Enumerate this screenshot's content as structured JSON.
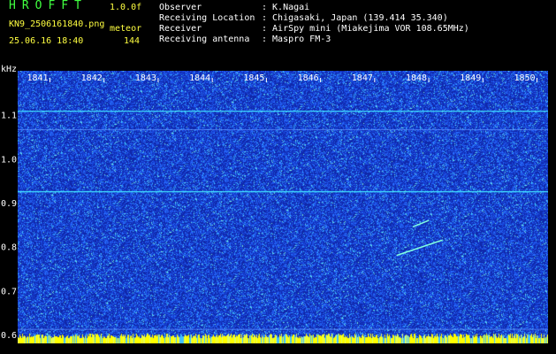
{
  "header": {
    "brand": "HROFFT",
    "version": "1.0.0f",
    "filename": "KN9_2506161840.png",
    "mode": "meteor",
    "datetime": "25.06.16 18:40",
    "count": "144"
  },
  "info": [
    {
      "label": "Observer",
      "value": ": K.Nagai"
    },
    {
      "label": "Receiving Location",
      "value": ": Chigasaki, Japan (139.414 35.340)"
    },
    {
      "label": "Receiver",
      "value": ": AirSpy mini (Miakejima VOR 108.65MHz)"
    },
    {
      "label": "Receiving antenna",
      "value": ": Maspro FM-3"
    }
  ],
  "chart_data": {
    "type": "heatmap",
    "ylabel": "kHz",
    "yticks": [
      "1.1",
      "1.0",
      "0.9",
      "0.8",
      "0.7",
      "0.6"
    ],
    "ytick_values": [
      1.1,
      1.0,
      0.9,
      0.8,
      0.7,
      0.6
    ],
    "ylim": [
      0.58,
      1.2
    ],
    "xticks": [
      "1841",
      "1842",
      "1843",
      "1844",
      "1845",
      "1846",
      "1847",
      "1848",
      "1849",
      "1850"
    ],
    "xtick_values": [
      1841,
      1842,
      1843,
      1844,
      1845,
      1846,
      1847,
      1848,
      1849,
      1850
    ],
    "xlim": [
      1840.6,
      1850.4
    ],
    "carrier_lines_khz": [
      1.108,
      0.925
    ],
    "faint_lines_khz": [
      1.066,
      0.612
    ],
    "meteor_echoes": [
      {
        "x": [
          1847.6,
          1848.45
        ],
        "y": [
          0.78,
          0.815
        ]
      },
      {
        "x": [
          1847.9,
          1848.2
        ],
        "y": [
          0.845,
          0.86
        ]
      }
    ],
    "colors": {
      "background": "#1030b0",
      "noise": "#2060ff",
      "signal": "#40e0ff",
      "text": "#ffffff",
      "header": "#ffff40",
      "brand": "#40ff40",
      "bottom_bar": "#ffff00"
    }
  }
}
